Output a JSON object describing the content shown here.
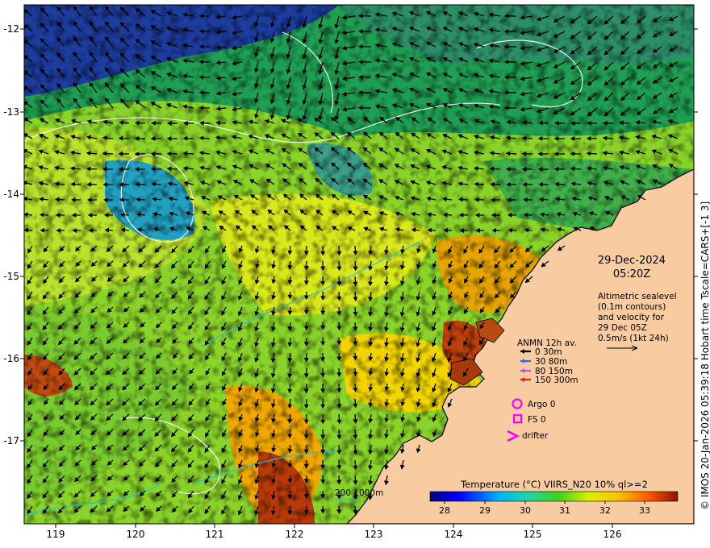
{
  "map": {
    "lon_ticks": [
      "119",
      "120",
      "121",
      "122",
      "123",
      "124",
      "125",
      "126"
    ],
    "lat_ticks": [
      "-12",
      "-13",
      "-14",
      "-15",
      "-16",
      "-17"
    ],
    "date": "29-Dec-2024",
    "time": "05:20Z",
    "altimetry_lines": [
      "Altimetric sealevel",
      "(0.1m contours)",
      "and velocity for",
      "29 Dec 05Z",
      "0.5m/s (1kt 24h)"
    ],
    "legend_title": "ANMN 12h av.",
    "legend_items": [
      {
        "label": "0 30m",
        "color": "#000000"
      },
      {
        "label": "30 80m",
        "color": "#1e6cff"
      },
      {
        "label": "80 150m",
        "color": "#b44cff"
      },
      {
        "label": "150 300m",
        "color": "#ff1a1a"
      }
    ],
    "argo_label": "Argo 0",
    "fs_label": "FS 0",
    "drifter_label": "drifter",
    "marker_color": "#ff00ff",
    "depth_label": "200  1000m",
    "colorbar_title": "Temperature (°C) VIIRS_N20 10% ql>=2",
    "colorbar_ticks": [
      "28",
      "29",
      "30",
      "31",
      "32",
      "33"
    ],
    "credit": "© IMOS 20-Jan-2026 05:39:18 Hobart time Tscale=CARS+[-1 3]",
    "land_color": "#f9cba1"
  }
}
